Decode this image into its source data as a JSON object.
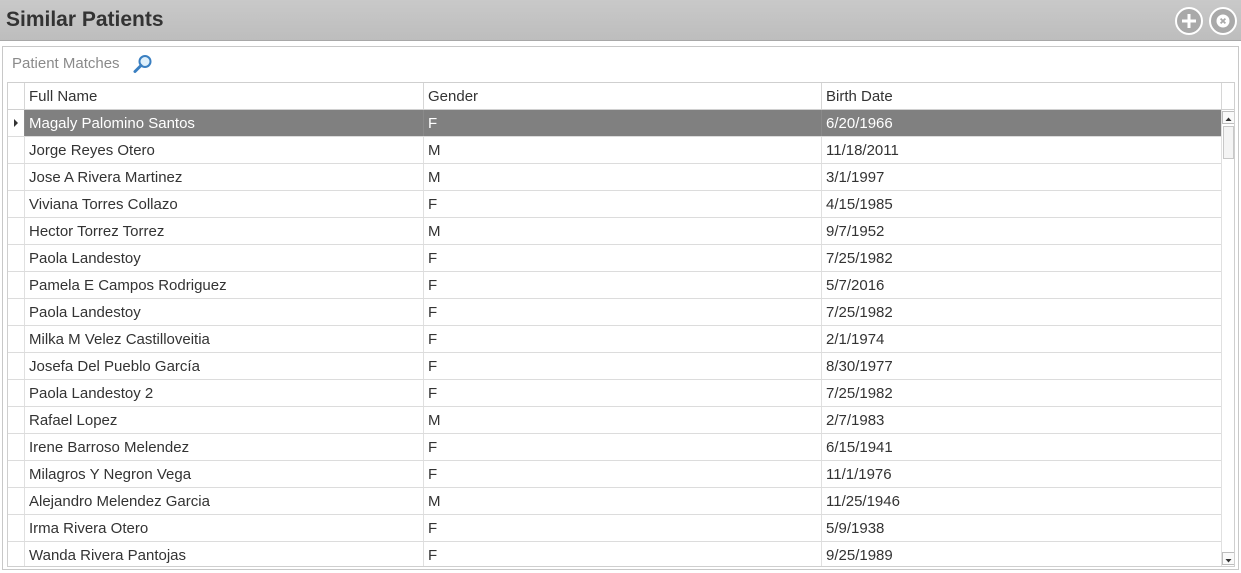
{
  "window": {
    "title": "Similar Patients"
  },
  "search": {
    "label": "Patient Matches"
  },
  "table": {
    "columns": [
      "Full Name",
      "Gender",
      "Birth Date"
    ],
    "selected_index": 0,
    "rows": [
      [
        "Magaly Palomino Santos",
        "F",
        "6/20/1966"
      ],
      [
        "Jorge Reyes Otero",
        "M",
        "11/18/2011"
      ],
      [
        "Jose A Rivera Martinez",
        "M",
        "3/1/1997"
      ],
      [
        "Viviana Torres Collazo",
        "F",
        "4/15/1985"
      ],
      [
        "Hector Torrez Torrez",
        "M",
        "9/7/1952"
      ],
      [
        "Paola Landestoy",
        "F",
        "7/25/1982"
      ],
      [
        "Pamela E Campos Rodriguez",
        "F",
        "5/7/2016"
      ],
      [
        "Paola Landestoy",
        "F",
        "7/25/1982"
      ],
      [
        "Milka M Velez Castilloveitia",
        "F",
        "2/1/1974"
      ],
      [
        "Josefa Del Pueblo García",
        "F",
        "8/30/1977"
      ],
      [
        "Paola Landestoy 2",
        "F",
        "7/25/1982"
      ],
      [
        "Rafael Lopez",
        "M",
        "2/7/1983"
      ],
      [
        "Irene Barroso Melendez",
        "F",
        "6/15/1941"
      ],
      [
        "Milagros Y Negron Vega",
        "F",
        "11/1/1976"
      ],
      [
        "Alejandro Melendez Garcia",
        "M",
        "11/25/1946"
      ],
      [
        "Irma Rivera Otero",
        "F",
        "5/9/1938"
      ],
      [
        "Wanda Rivera Pantojas",
        "F",
        "9/25/1989"
      ]
    ]
  },
  "colors": {
    "titlebar": "#c2c2c2",
    "selected_row": "#808080",
    "search_icon": "#3a7fc1"
  }
}
